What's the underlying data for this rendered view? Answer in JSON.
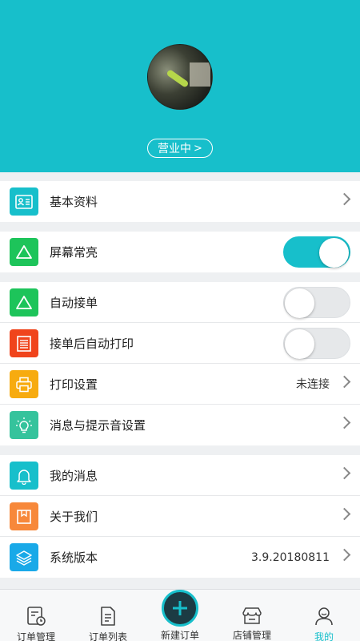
{
  "header": {
    "status_label": "营业中",
    "status_chevron": ">"
  },
  "groups": {
    "profile": {
      "label": "基本资料"
    },
    "screen": {
      "label": "屏幕常亮",
      "toggle_on": true
    },
    "auto_accept": {
      "label": "自动接单",
      "toggle_on": false
    },
    "auto_print": {
      "label": "接单后自动打印",
      "toggle_on": false
    },
    "print_settings": {
      "label": "打印设置",
      "value": "未连接"
    },
    "notify_settings": {
      "label": "消息与提示音设置"
    },
    "my_messages": {
      "label": "我的消息"
    },
    "about": {
      "label": "关于我们"
    },
    "version": {
      "label": "系统版本",
      "value": "3.9.20180811"
    }
  },
  "tabbar": {
    "items": [
      {
        "label": "订单管理",
        "icon": "order-manage-icon"
      },
      {
        "label": "订单列表",
        "icon": "order-list-icon"
      },
      {
        "label": "新建订单",
        "icon": "add-icon"
      },
      {
        "label": "店铺管理",
        "icon": "store-icon"
      },
      {
        "label": "我的",
        "icon": "profile-icon"
      }
    ]
  },
  "colors": {
    "accent": "#17bfcb",
    "profile_icon": "#17bfcb",
    "screen_icon": "#1dc45a",
    "auto_accept_icon": "#1dc45a",
    "auto_print_icon": "#f0441c",
    "print_settings_icon": "#f7ab0f",
    "notify_icon": "#35c39c",
    "messages_icon": "#17bfcb",
    "about_icon": "#f7883a",
    "version_icon": "#19a9e8"
  }
}
